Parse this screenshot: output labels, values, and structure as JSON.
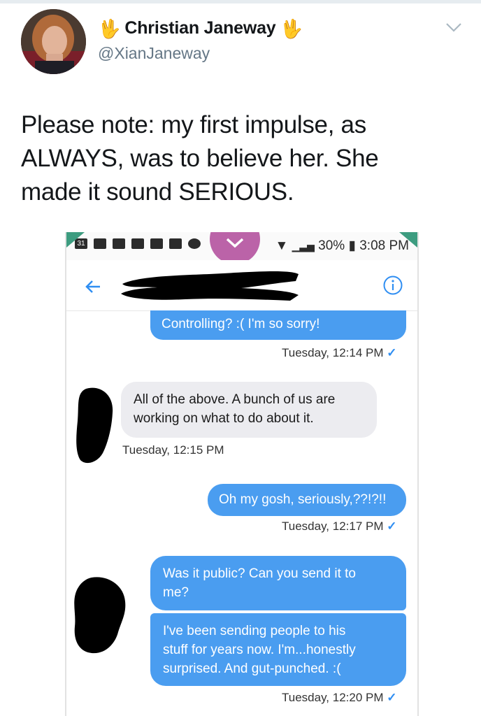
{
  "tweet": {
    "display_name": "Christian Janeway",
    "name_emoji_left": "🖖",
    "name_emoji_right": "🖖",
    "handle": "@XianJaneway",
    "text_lines": [
      "Please note: my first impulse, as",
      "ALWAYS, was to believe her. She",
      "made it sound SERIOUS."
    ],
    "menu_icon": "chevron-down-icon"
  },
  "screenshot": {
    "status_bar": {
      "left_badge": "31",
      "battery_pct": "30%",
      "time": "3:08 PM",
      "icons": [
        "calendar-icon",
        "square-icon",
        "square-icon",
        "app-icon",
        "message-icon",
        "gallery-icon",
        "alarm-icon",
        "check-icon",
        "wifi-icon",
        "signal-icon",
        "battery-icon"
      ],
      "pull_icon": "chevron-down-icon"
    },
    "header": {
      "back_icon": "back-arrow-icon",
      "info_icon": "info-icon"
    },
    "messages": [
      {
        "direction": "out",
        "text": "Controlling? :( I'm so sorry!"
      },
      {
        "direction": "in",
        "text_lines": [
          "All of the above. A bunch of us are",
          "working on what to do about it."
        ]
      },
      {
        "direction": "out",
        "text": "Oh my gosh, seriously,??!?!!"
      },
      {
        "direction": "out",
        "text_lines": [
          "Was it public? Can you send it to",
          "me?"
        ]
      },
      {
        "direction": "out",
        "text_lines": [
          "I've been sending people to his",
          "stuff for years now. I'm...honestly",
          "surprised. And gut-punched. :("
        ]
      }
    ],
    "timestamps": [
      {
        "text": "Tuesday, 12:14 PM",
        "check": "✓"
      },
      {
        "text": "Tuesday, 12:15 PM",
        "check": ""
      },
      {
        "text": "Tuesday, 12:17 PM",
        "check": "✓"
      },
      {
        "text": "Tuesday, 12:20 PM",
        "check": "✓"
      }
    ],
    "colors": {
      "outgoing_bubble": "#4a9df0",
      "incoming_bubble": "#ececf0",
      "accent": "#2f8ef2",
      "pull_tab": "#bb63a8"
    }
  }
}
